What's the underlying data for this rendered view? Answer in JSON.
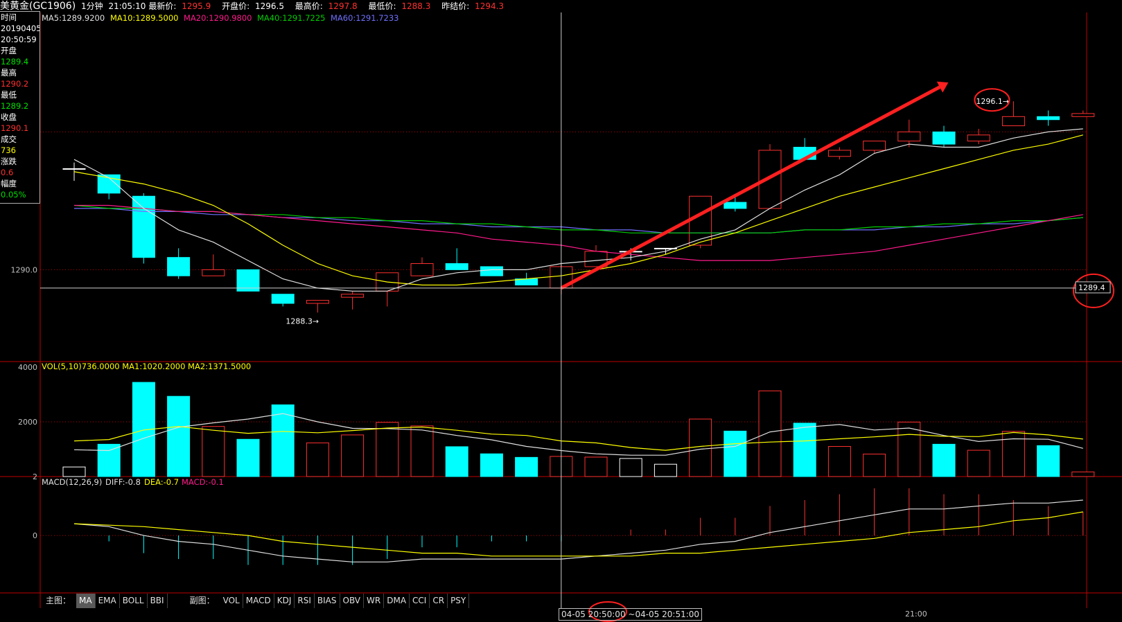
{
  "header": {
    "symbol": "美黄金(GC1906)",
    "period": "1分钟",
    "time": "21:05:10",
    "last_label": "最新价:",
    "last": "1295.9",
    "open_label": "开盘价:",
    "open": "1296.5",
    "high_label": "最高价:",
    "high": "1297.8",
    "low_label": "最低价:",
    "low": "1288.3",
    "prev_label": "昨结价:",
    "prev": "1294.3"
  },
  "info": {
    "time_label": "时间",
    "date": "20190405",
    "time": "20:50:59",
    "open_label": "开盘",
    "open": "1289.4",
    "high_label": "最高",
    "high": "1290.2",
    "low_label": "最低",
    "low": "1289.2",
    "close_label": "收盘",
    "close": "1290.1",
    "vol_label": "成交",
    "vol": "736",
    "chg_label": "涨跌",
    "chg": "0.6",
    "pct_label": "幅度",
    "pct": "0.05%"
  },
  "ma_legend": [
    {
      "text": "MA5:1289.9200",
      "color": "#e0e0e0"
    },
    {
      "text": "MA10:1289.5000",
      "color": "#ffff00"
    },
    {
      "text": "MA20:1290.9800",
      "color": "#ff1a8c"
    },
    {
      "text": "MA40:1291.7225",
      "color": "#00d000"
    },
    {
      "text": "MA60:1291.7233",
      "color": "#7070ff"
    }
  ],
  "vol_legend": {
    "text": "VOL(5,10)736.0000",
    "ma1": "MA1:1020.2000",
    "ma2": "MA2:1371.5000"
  },
  "macd_legend": {
    "text": "MACD(12,26,9)",
    "diff": "DIFF:-0.8",
    "dea": "DEA:-0.7",
    "macd": "MACD:-0.1"
  },
  "price_label": "1290.0",
  "vol_labels": [
    "4000",
    "2000"
  ],
  "macd_labels": [
    "2",
    "0"
  ],
  "crosshair_price": "1289.4",
  "annotations": {
    "low": "1288.3",
    "high": "1296.1"
  },
  "tabs_main_label": "主图：",
  "tabs_main": [
    "MA",
    "EMA",
    "BOLL",
    "BBI"
  ],
  "tabs_sub_label": "副图：",
  "tabs_sub": [
    "VOL",
    "MACD",
    "KDJ",
    "RSI",
    "BIAS",
    "OBV",
    "WR",
    "DMA",
    "CCI",
    "CR",
    "PSY"
  ],
  "time_range": "04-05 20:50:00 ~04-05 20:51:00",
  "time_tick": "21:00",
  "colors": {
    "up": "#ff3030",
    "down": "#00ffff",
    "flat": "#ffffff",
    "grid": "#c00000",
    "arrow": "#ff2020"
  },
  "chart_data": {
    "type": "candlestick",
    "candles": [
      {
        "o": 1293.3,
        "c": 1293.3,
        "h": 1293.5,
        "l": 1292.9
      },
      {
        "o": 1293.1,
        "c": 1292.5,
        "h": 1293.1,
        "l": 1292.3
      },
      {
        "o": 1292.4,
        "c": 1290.4,
        "h": 1292.5,
        "l": 1290.2
      },
      {
        "o": 1290.4,
        "c": 1289.8,
        "h": 1290.7,
        "l": 1289.7
      },
      {
        "o": 1289.8,
        "c": 1290.0,
        "h": 1290.5,
        "l": 1289.8
      },
      {
        "o": 1290.0,
        "c": 1289.3,
        "h": 1290.0,
        "l": 1289.3
      },
      {
        "o": 1289.2,
        "c": 1288.9,
        "h": 1289.2,
        "l": 1288.8
      },
      {
        "o": 1288.9,
        "c": 1289.0,
        "h": 1289.0,
        "l": 1288.6
      },
      {
        "o": 1289.1,
        "c": 1289.2,
        "h": 1289.3,
        "l": 1288.7
      },
      {
        "o": 1289.3,
        "c": 1289.9,
        "h": 1289.9,
        "l": 1288.8
      },
      {
        "o": 1289.8,
        "c": 1290.2,
        "h": 1290.4,
        "l": 1289.8
      },
      {
        "o": 1290.2,
        "c": 1290.0,
        "h": 1290.7,
        "l": 1290.0
      },
      {
        "o": 1290.1,
        "c": 1289.8,
        "h": 1290.1,
        "l": 1289.8
      },
      {
        "o": 1289.7,
        "c": 1289.5,
        "h": 1289.9,
        "l": 1289.5
      },
      {
        "o": 1289.4,
        "c": 1290.1,
        "h": 1290.2,
        "l": 1289.2
      },
      {
        "o": 1290.1,
        "c": 1290.6,
        "h": 1290.8,
        "l": 1290.1
      },
      {
        "o": 1290.6,
        "c": 1290.6,
        "h": 1290.7,
        "l": 1290.3
      },
      {
        "o": 1290.7,
        "c": 1290.7,
        "h": 1290.7,
        "l": 1290.5
      },
      {
        "o": 1290.8,
        "c": 1292.4,
        "h": 1292.4,
        "l": 1290.7
      },
      {
        "o": 1292.2,
        "c": 1292.0,
        "h": 1292.4,
        "l": 1291.9
      },
      {
        "o": 1292.0,
        "c": 1293.9,
        "h": 1294.1,
        "l": 1292.0
      },
      {
        "o": 1294.0,
        "c": 1293.6,
        "h": 1294.3,
        "l": 1293.6
      },
      {
        "o": 1293.7,
        "c": 1293.9,
        "h": 1294.0,
        "l": 1293.6
      },
      {
        "o": 1293.9,
        "c": 1294.2,
        "h": 1294.2,
        "l": 1293.8
      },
      {
        "o": 1294.2,
        "c": 1294.5,
        "h": 1294.9,
        "l": 1294.0
      },
      {
        "o": 1294.5,
        "c": 1294.1,
        "h": 1294.7,
        "l": 1294.0
      },
      {
        "o": 1294.2,
        "c": 1294.4,
        "h": 1294.6,
        "l": 1294.1
      },
      {
        "o": 1294.7,
        "c": 1295.0,
        "h": 1295.5,
        "l": 1294.7
      },
      {
        "o": 1295.0,
        "c": 1294.9,
        "h": 1295.2,
        "l": 1294.7
      },
      {
        "o": 1295.0,
        "c": 1295.1,
        "h": 1295.2,
        "l": 1295.0
      }
    ],
    "ma5": [
      1293.6,
      1293.0,
      1292.0,
      1291.3,
      1290.9,
      1290.3,
      1289.7,
      1289.4,
      1289.3,
      1289.3,
      1289.7,
      1289.9,
      1290.0,
      1290.0,
      1290.2,
      1290.3,
      1290.4,
      1290.6,
      1291.0,
      1291.3,
      1292.0,
      1292.6,
      1293.1,
      1293.8,
      1294.1,
      1294.0,
      1294.0,
      1294.3,
      1294.5,
      1294.6
    ],
    "ma10": [
      1293.2,
      1293.0,
      1292.8,
      1292.5,
      1292.1,
      1291.5,
      1290.8,
      1290.2,
      1289.8,
      1289.6,
      1289.5,
      1289.5,
      1289.6,
      1289.7,
      1289.8,
      1290.0,
      1290.2,
      1290.5,
      1290.9,
      1291.2,
      1291.6,
      1292.0,
      1292.4,
      1292.7,
      1293.0,
      1293.3,
      1293.6,
      1293.9,
      1294.1,
      1294.4
    ],
    "ma20": [
      1292.1,
      1292.1,
      1292.0,
      1291.9,
      1291.9,
      1291.8,
      1291.7,
      1291.6,
      1291.5,
      1291.4,
      1291.3,
      1291.2,
      1291.0,
      1290.9,
      1290.8,
      1290.6,
      1290.5,
      1290.4,
      1290.3,
      1290.3,
      1290.3,
      1290.4,
      1290.5,
      1290.6,
      1290.8,
      1291.0,
      1291.2,
      1291.4,
      1291.6,
      1291.8
    ],
    "ma40": [
      1292.1,
      1292.0,
      1292.0,
      1291.9,
      1291.9,
      1291.8,
      1291.8,
      1291.7,
      1291.7,
      1291.6,
      1291.6,
      1291.5,
      1291.5,
      1291.4,
      1291.3,
      1291.3,
      1291.2,
      1291.2,
      1291.2,
      1291.2,
      1291.2,
      1291.3,
      1291.3,
      1291.4,
      1291.4,
      1291.5,
      1291.5,
      1291.6,
      1291.6,
      1291.7
    ],
    "ma60": [
      1292.0,
      1292.0,
      1291.9,
      1291.9,
      1291.8,
      1291.8,
      1291.7,
      1291.7,
      1291.6,
      1291.6,
      1291.5,
      1291.5,
      1291.4,
      1291.4,
      1291.4,
      1291.3,
      1291.3,
      1291.2,
      1291.2,
      1291.2,
      1291.2,
      1291.3,
      1291.3,
      1291.3,
      1291.4,
      1291.4,
      1291.5,
      1291.5,
      1291.6,
      1291.7
    ],
    "volume": [
      350,
      1180,
      3440,
      2930,
      1830,
      1360,
      2620,
      1230,
      1520,
      1980,
      1850,
      1090,
      830,
      700,
      736,
      710,
      660,
      450,
      2100,
      1660,
      3130,
      1950,
      1100,
      820,
      1990,
      1180,
      960,
      1650,
      1130,
      170
    ],
    "vol_ma1": [
      980,
      950,
      1400,
      1800,
      1960,
      2100,
      2300,
      2000,
      1760,
      1750,
      1700,
      1500,
      1340,
      1100,
      950,
      830,
      780,
      780,
      1000,
      1100,
      1630,
      1800,
      1900,
      1700,
      1770,
      1500,
      1280,
      1380,
      1360,
      1030
    ],
    "vol_ma2": [
      1300,
      1350,
      1700,
      1830,
      1690,
      1580,
      1650,
      1600,
      1680,
      1770,
      1810,
      1690,
      1550,
      1500,
      1300,
      1230,
      1060,
      960,
      1100,
      1200,
      1260,
      1300,
      1380,
      1450,
      1540,
      1470,
      1460,
      1610,
      1520,
      1370
    ],
    "diff": [
      0.4,
      0.3,
      0.0,
      -0.2,
      -0.3,
      -0.5,
      -0.7,
      -0.8,
      -0.9,
      -0.9,
      -0.8,
      -0.8,
      -0.8,
      -0.8,
      -0.8,
      -0.7,
      -0.6,
      -0.5,
      -0.3,
      -0.2,
      0.1,
      0.3,
      0.5,
      0.7,
      0.9,
      0.9,
      1.0,
      1.1,
      1.1,
      1.2
    ],
    "dea": [
      0.4,
      0.35,
      0.3,
      0.2,
      0.1,
      0.0,
      -0.2,
      -0.3,
      -0.4,
      -0.5,
      -0.6,
      -0.6,
      -0.7,
      -0.7,
      -0.7,
      -0.7,
      -0.7,
      -0.6,
      -0.6,
      -0.5,
      -0.4,
      -0.3,
      -0.2,
      -0.1,
      0.1,
      0.2,
      0.3,
      0.5,
      0.6,
      0.8
    ],
    "macd": [
      0.0,
      -0.1,
      -0.3,
      -0.4,
      -0.4,
      -0.5,
      -0.5,
      -0.5,
      -0.5,
      -0.4,
      -0.2,
      -0.2,
      -0.1,
      -0.1,
      -0.1,
      0.0,
      0.1,
      0.1,
      0.3,
      0.3,
      0.5,
      0.6,
      0.7,
      0.8,
      0.8,
      0.7,
      0.7,
      0.6,
      0.5,
      0.4
    ],
    "price_range": [
      1287.0,
      1298.4
    ],
    "vol_range": [
      0,
      4200
    ],
    "macd_range": [
      -1.95,
      2.0
    ]
  }
}
